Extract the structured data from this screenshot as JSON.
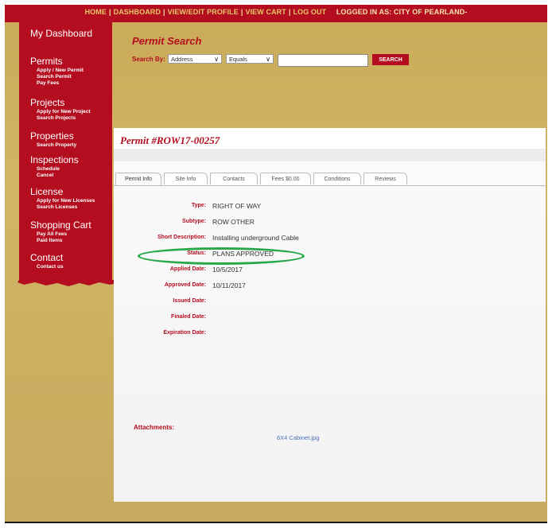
{
  "nav": {
    "home": "HOME",
    "dashboard": "DASHBOARD",
    "edit_profile": "VIEW/EDIT PROFILE",
    "view_cart": "VIEW CART",
    "logout": "LOG OUT",
    "logged_in_as": "LOGGED IN AS:  CITY OF PEARLAND-",
    "overflow": "-------"
  },
  "sidebar": {
    "dashboard": "My Dashboard",
    "permits": {
      "title": "Permits",
      "links": [
        "Apply / New Permit",
        "Search Permit",
        "Pay Fees"
      ]
    },
    "projects": {
      "title": "Projects",
      "links": [
        "Apply for New Project",
        "Search Projects"
      ]
    },
    "properties": {
      "title": "Properties",
      "links": [
        "Search Property"
      ]
    },
    "inspections": {
      "title": "Inspections",
      "links": [
        "Schedule",
        "Cancel"
      ]
    },
    "license": {
      "title": "License",
      "links": [
        "Apply for New Licenses",
        "Search Licenses"
      ]
    },
    "shopping_cart": {
      "title": "Shopping Cart",
      "links": [
        "Pay All Fees",
        "Paid Items"
      ]
    },
    "contact": {
      "title": "Contact",
      "links": [
        "Contact us"
      ]
    }
  },
  "search": {
    "title": "Permit Search",
    "by_label": "Search By:",
    "field": "Address",
    "operator": "Equals",
    "query": "",
    "button": "SEARCH"
  },
  "tabs": [
    "Permit Info",
    "Site Info",
    "Contacts",
    "Fees $0.00",
    "Conditions",
    "Reviews"
  ],
  "permit": {
    "title": "Permit #ROW17-00257",
    "fields": [
      {
        "label": "Type:",
        "value": "RIGHT OF WAY"
      },
      {
        "label": "Subtype:",
        "value": "ROW OTHER"
      },
      {
        "label": "Short Description:",
        "value": "Installing underground Cable"
      },
      {
        "label": "Status:",
        "value": "PLANS APPROVED"
      },
      {
        "label": "Applied Date:",
        "value": "10/5/2017"
      },
      {
        "label": "Approved Date:",
        "value": "10/11/2017"
      },
      {
        "label": "Issued Date:",
        "value": ""
      },
      {
        "label": "Finaled Date:",
        "value": ""
      },
      {
        "label": "Expiration Date:",
        "value": ""
      }
    ]
  },
  "attachments": {
    "label": "Attachments:",
    "files": [
      "6X4 Cabinet.jpg"
    ]
  },
  "colors": {
    "brand_red": "#b30d1f",
    "background_gold": "#c9aa59",
    "nav_text": "#e8c86a",
    "highlight_green": "#29a84a",
    "link_blue": "#4770b8"
  }
}
